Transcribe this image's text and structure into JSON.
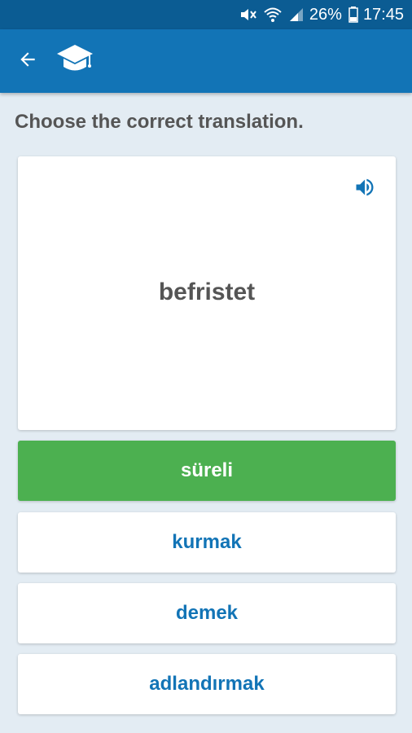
{
  "status_bar": {
    "battery": "26%",
    "time": "17:45"
  },
  "app_bar": {
    "back_icon": "arrow-left-icon",
    "logo_icon": "graduation-cap-icon"
  },
  "quiz": {
    "instruction": "Choose the correct translation.",
    "word": "befristet",
    "speaker_icon": "speaker-icon",
    "options": [
      {
        "label": "süreli",
        "state": "correct"
      },
      {
        "label": "kurmak",
        "state": "default"
      },
      {
        "label": "demek",
        "state": "default"
      },
      {
        "label": "adlandırmak",
        "state": "default"
      }
    ]
  },
  "colors": {
    "status_bar": "#0b5c93",
    "app_bar": "#1274b6",
    "background": "#e3ecf3",
    "correct": "#4cb050",
    "option_text": "#1274b6",
    "text_gray": "#555555"
  }
}
